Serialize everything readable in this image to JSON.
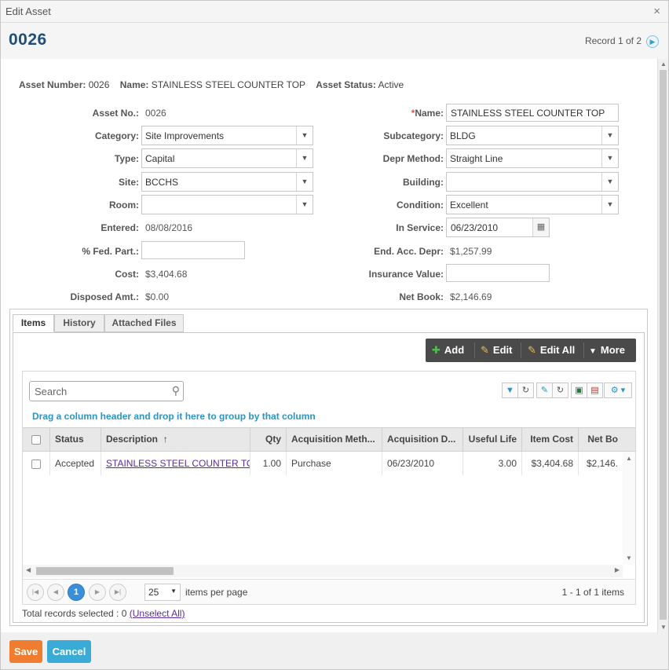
{
  "dialog": {
    "title": "Edit Asset",
    "close": "×"
  },
  "header": {
    "record_number": "0026",
    "record_count": "Record 1 of 2",
    "next_icon": "▶"
  },
  "summary": {
    "asset_number_label": "Asset Number:",
    "asset_number": "0026",
    "name_label": "Name:",
    "name": "STAINLESS STEEL COUNTER TOP",
    "status_label": "Asset Status:",
    "status": "Active"
  },
  "form": {
    "asset_no_label": "Asset No.:",
    "asset_no": "0026",
    "name_required": "*",
    "name_label": "Name:",
    "name": "STAINLESS STEEL COUNTER TOP",
    "category_label": "Category:",
    "category": "Site Improvements",
    "subcategory_label": "Subcategory:",
    "subcategory": "BLDG",
    "type_label": "Type:",
    "type": "Capital",
    "depr_method_label": "Depr Method:",
    "depr_method": "Straight Line",
    "site_label": "Site:",
    "site": "BCCHS",
    "building_label": "Building:",
    "building": "",
    "room_label": "Room:",
    "room": "",
    "condition_label": "Condition:",
    "condition": "Excellent",
    "entered_label": "Entered:",
    "entered": "08/08/2016",
    "in_service_label": "In Service:",
    "in_service": "06/23/2010",
    "fed_part_label": "% Fed. Part.:",
    "fed_part": "",
    "end_acc_depr_label": "End. Acc. Depr:",
    "end_acc_depr": "$1,257.99",
    "cost_label": "Cost:",
    "cost": "$3,404.68",
    "insurance_label": "Insurance Value:",
    "insurance": "",
    "disposed_label": "Disposed Amt.:",
    "disposed": "$0.00",
    "net_book_label": "Net Book:",
    "net_book": "$2,146.69"
  },
  "tabs": [
    "Items",
    "History",
    "Attached Files"
  ],
  "toolbar": {
    "add": "Add",
    "edit": "Edit",
    "edit_all": "Edit All",
    "more": "More"
  },
  "grid": {
    "search_placeholder": "Search",
    "group_hint": "Drag a column header and drop it here to group by that column",
    "columns": [
      "Status",
      "Description",
      "Qty",
      "Acquisition Meth...",
      "Acquisition D...",
      "Useful Life",
      "Item Cost",
      "Net Bo"
    ],
    "sort_indicator": "↑",
    "rows": [
      {
        "status": "Accepted",
        "description": "STAINLESS STEEL COUNTER TOP",
        "qty": "1.00",
        "acq_method": "Purchase",
        "acq_date": "06/23/2010",
        "useful_life": "3.00",
        "item_cost": "$3,404.68",
        "net_book": "$2,146."
      }
    ],
    "pager": {
      "current_page": "1",
      "page_size": "25",
      "per_page_label": "items per page",
      "info": "1 - 1 of 1 items"
    },
    "totals_label": "Total records selected : 0",
    "unselect_all": "(Unselect All)"
  },
  "footer": {
    "save": "Save",
    "cancel": "Cancel"
  },
  "colors": {
    "save": "#f07d2f",
    "cancel": "#3aaad6",
    "title": "#1f4e79",
    "link": "#2a95c5",
    "toolbar": "#4a4a4a"
  }
}
